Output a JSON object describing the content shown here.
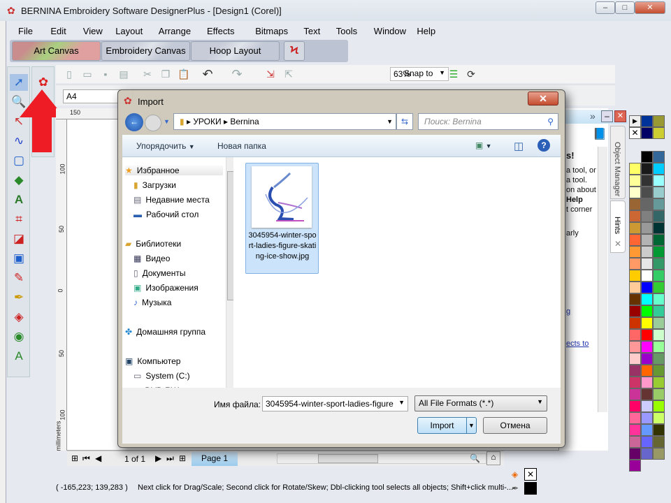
{
  "app": {
    "title": "BERNINA Embroidery Software DesignerPlus - [Design1 (Corel)]"
  },
  "menu": [
    "File",
    "Edit",
    "View",
    "Layout",
    "Arrange",
    "Effects",
    "Bitmaps",
    "Text",
    "Tools",
    "Window",
    "Help"
  ],
  "canvas_tabs": [
    "Art Canvas",
    "Embroidery Canvas",
    "Hoop Layout"
  ],
  "toolbar": {
    "zoom": "63%",
    "snap": "Snap to"
  },
  "propbar": {
    "page_size": "A4"
  },
  "ruler": {
    "top": "150",
    "left": [
      "100",
      "50",
      "0",
      "50",
      "100"
    ],
    "unit": "millimeters"
  },
  "hints_partial": [
    "s!",
    "a tool, or",
    "a tool.",
    "on about",
    "Help",
    "t corner",
    "arly",
    "g",
    "ects to"
  ],
  "docker_tabs": {
    "object_manager": "Object Manager",
    "hints": "Hints"
  },
  "navigation": {
    "page_count": "1 of 1",
    "page_tab": "Page 1"
  },
  "status": {
    "coords": "( -165,223; 139,283 )",
    "message": "Next click for Drag/Scale; Second click for Rotate/Skew; Dbl-clicking tool selects all objects; Shift+click multi-..."
  },
  "dialog": {
    "title": "Import",
    "breadcrumb": [
      "УРОКИ",
      "Bernina"
    ],
    "search_placeholder": "Поиск: Bernina",
    "organize": "Упорядочить",
    "new_folder": "Новая папка",
    "nav": [
      {
        "label": "Избранное",
        "level": 0,
        "icon": "star-icon"
      },
      {
        "label": "Загрузки",
        "level": 1,
        "icon": "downloads-icon"
      },
      {
        "label": "Недавние места",
        "level": 1,
        "icon": "recent-icon"
      },
      {
        "label": "Рабочий стол",
        "level": 1,
        "icon": "desktop-icon"
      },
      {
        "label": "Библиотеки",
        "level": 0,
        "icon": "libraries-icon"
      },
      {
        "label": "Видео",
        "level": 1,
        "icon": "video-icon"
      },
      {
        "label": "Документы",
        "level": 1,
        "icon": "documents-icon"
      },
      {
        "label": "Изображения",
        "level": 1,
        "icon": "pictures-icon"
      },
      {
        "label": "Музыка",
        "level": 1,
        "icon": "music-icon"
      },
      {
        "label": "Домашняя группа",
        "level": 0,
        "icon": "homegroup-icon"
      },
      {
        "label": "Компьютер",
        "level": 0,
        "icon": "computer-icon"
      },
      {
        "label": "System (C:)",
        "level": 1,
        "icon": "drive-icon"
      },
      {
        "label": "DVD RW",
        "level": 1,
        "icon": "dvd-icon"
      }
    ],
    "file": {
      "name": "3045954-winter-sport-ladies-figure-skating-ice-show.jpg"
    },
    "filename_label": "Имя файла:",
    "filename_value": "3045954-winter-sport-ladies-figure",
    "filter": "All File Formats (*.*)",
    "import_btn": "Import",
    "cancel_btn": "Отмена"
  },
  "palette": [
    "#003399",
    "#999933",
    "#000066",
    "#CCCC33",
    "#000000",
    "#336699",
    "#FFFF66",
    "#1A1A1A",
    "#00CCFF",
    "#FFFF99",
    "#333333",
    "#99FFFF",
    "#FFFFCC",
    "#4D4D4D",
    "#99CCCC",
    "#996633",
    "#666666",
    "#669999",
    "#CC6633",
    "#808080",
    "#336666",
    "#CC9933",
    "#999999",
    "#003333",
    "#FF6633",
    "#B3B3B3",
    "#006633",
    "#FF9933",
    "#CCCCCC",
    "#009933",
    "#FF9966",
    "#E6E6E6",
    "#339966",
    "#FFCC00",
    "#FFFFFF",
    "#33CC66",
    "#FFCC99",
    "#0000FF",
    "#33CC33",
    "#663300",
    "#00FFFF",
    "#66FFCC",
    "#990000",
    "#00FF00",
    "#33CC99",
    "#CC3300",
    "#FFFF00",
    "#99CC99",
    "#FF6666",
    "#FF0000",
    "#CCFFCC",
    "#FF9999",
    "#FF00FF",
    "#99FF99",
    "#FFCCCC",
    "#9900CC",
    "#669966",
    "#993366",
    "#FF6600",
    "#669933",
    "#CC3366",
    "#FF99CC",
    "#99CC33",
    "#CC3399",
    "#663333",
    "#99CC66",
    "#FF0066",
    "#CCCCFF",
    "#99FF00",
    "#FF6699",
    "#9999FF",
    "#CCFF66",
    "#FF3399",
    "#6699FF",
    "#333300",
    "#CC6699",
    "#6666FF",
    "#666633",
    "#660066",
    "#6666CC",
    "#999966",
    "#990099"
  ]
}
